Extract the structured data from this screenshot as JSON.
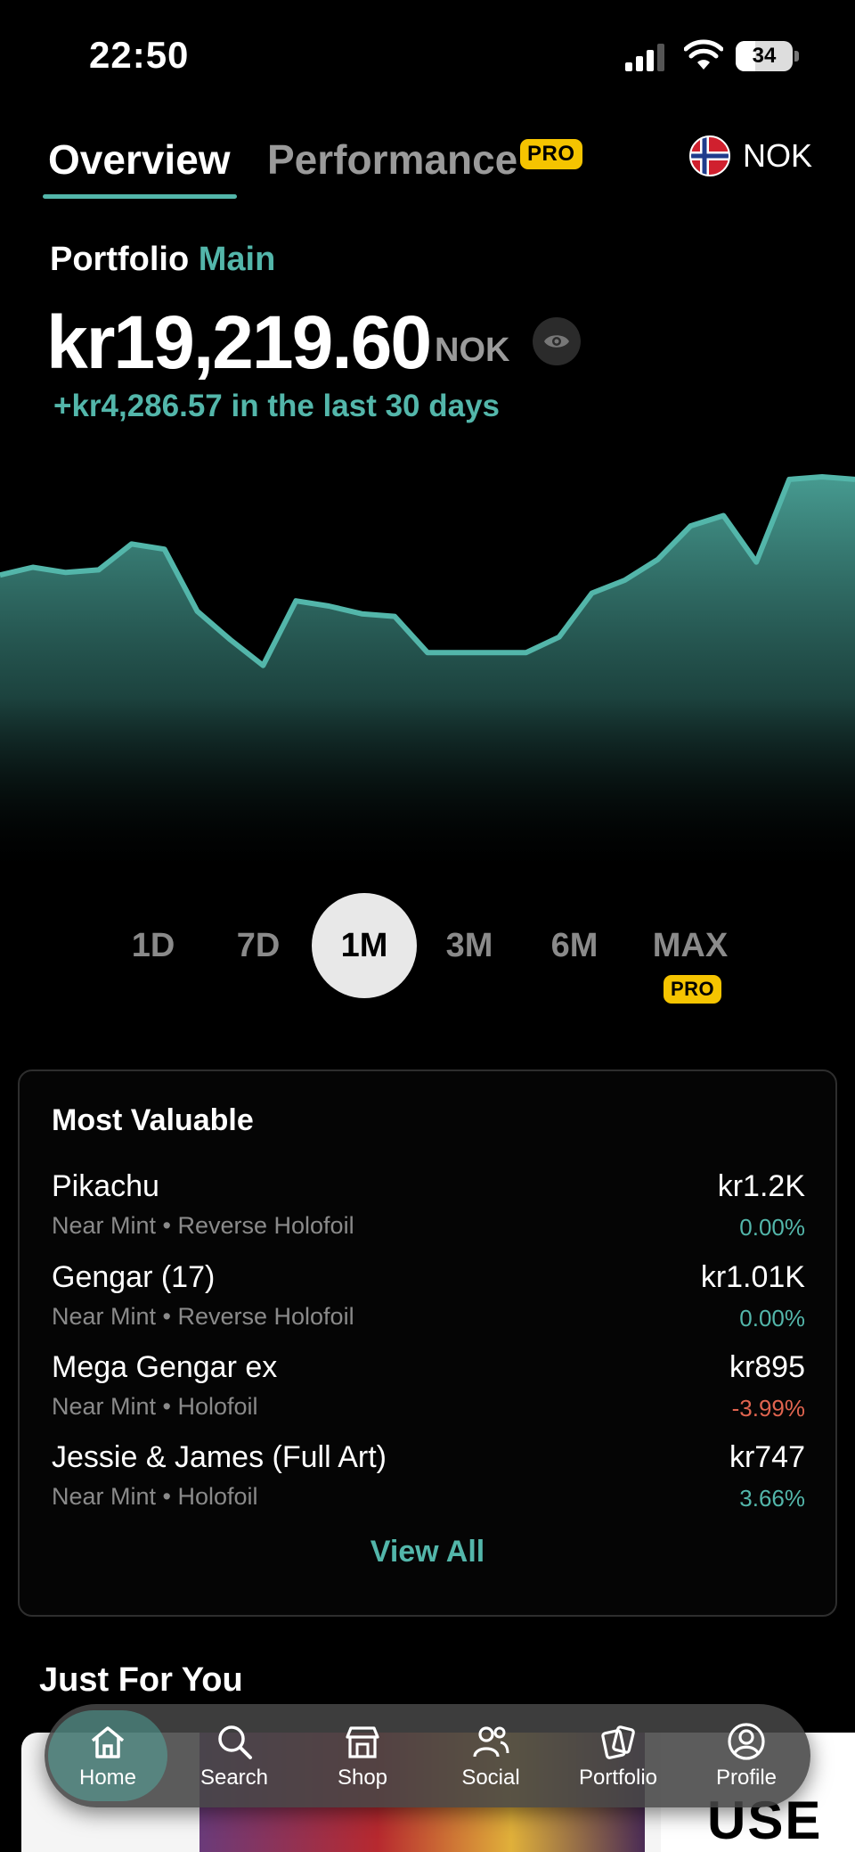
{
  "status_bar": {
    "time": "22:50",
    "battery": "34",
    "battery_level": 0.34
  },
  "tabs": {
    "overview": "Overview",
    "performance": "Performance",
    "pro_badge": "PRO",
    "currency": "NOK"
  },
  "portfolio": {
    "label": "Portfolio",
    "name": "Main",
    "value": "kr19,219.60",
    "currency": "NOK",
    "change": "+kr4,286.57 in the last 30 days"
  },
  "chart_data": {
    "type": "area",
    "series": [
      {
        "values": [
          0.38,
          0.35,
          0.37,
          0.36,
          0.26,
          0.28,
          0.52,
          0.63,
          0.73,
          0.48,
          0.5,
          0.53,
          0.54,
          0.68,
          0.68,
          0.68,
          0.68,
          0.62,
          0.45,
          0.4,
          0.32,
          0.19,
          0.15,
          0.33,
          0.01,
          0.0,
          0.01
        ]
      }
    ],
    "color": "#53b6aa",
    "grid": false
  },
  "range": {
    "options": [
      "1D",
      "7D",
      "1M",
      "3M",
      "6M",
      "MAX"
    ],
    "selected": "1M",
    "max_pro_badge": "PRO"
  },
  "most_valuable": {
    "title": "Most Valuable",
    "items": [
      {
        "name": "Pikachu",
        "sub": "Near Mint • Reverse Holofoil",
        "price": "kr1.2K",
        "change": "0.00%",
        "change_color": "#53b6aa"
      },
      {
        "name": "Gengar (17)",
        "sub": "Near Mint • Reverse Holofoil",
        "price": "kr1.01K",
        "change": "0.00%",
        "change_color": "#53b6aa"
      },
      {
        "name": "Mega Gengar ex",
        "sub": "Near Mint • Holofoil",
        "price": "kr895",
        "change": "-3.99%",
        "change_color": "#e0644f"
      },
      {
        "name": "Jessie & James (Full Art)",
        "sub": "Near Mint • Holofoil",
        "price": "kr747",
        "change": "3.66%",
        "change_color": "#53b6aa"
      }
    ],
    "view_all": "View All"
  },
  "just_for_you": {
    "title": "Just For You",
    "promo_text": "USE CO"
  },
  "nav": {
    "items": [
      {
        "label": "Home",
        "icon": "home-icon",
        "active": true
      },
      {
        "label": "Search",
        "icon": "search-icon",
        "active": false
      },
      {
        "label": "Shop",
        "icon": "shop-icon",
        "active": false
      },
      {
        "label": "Social",
        "icon": "social-icon",
        "active": false
      },
      {
        "label": "Portfolio",
        "icon": "portfolio-icon",
        "active": false
      },
      {
        "label": "Profile",
        "icon": "profile-icon",
        "active": false
      }
    ]
  },
  "colors": {
    "accent": "#53b6aa",
    "pro": "#f5c400",
    "negative": "#e0644f"
  }
}
